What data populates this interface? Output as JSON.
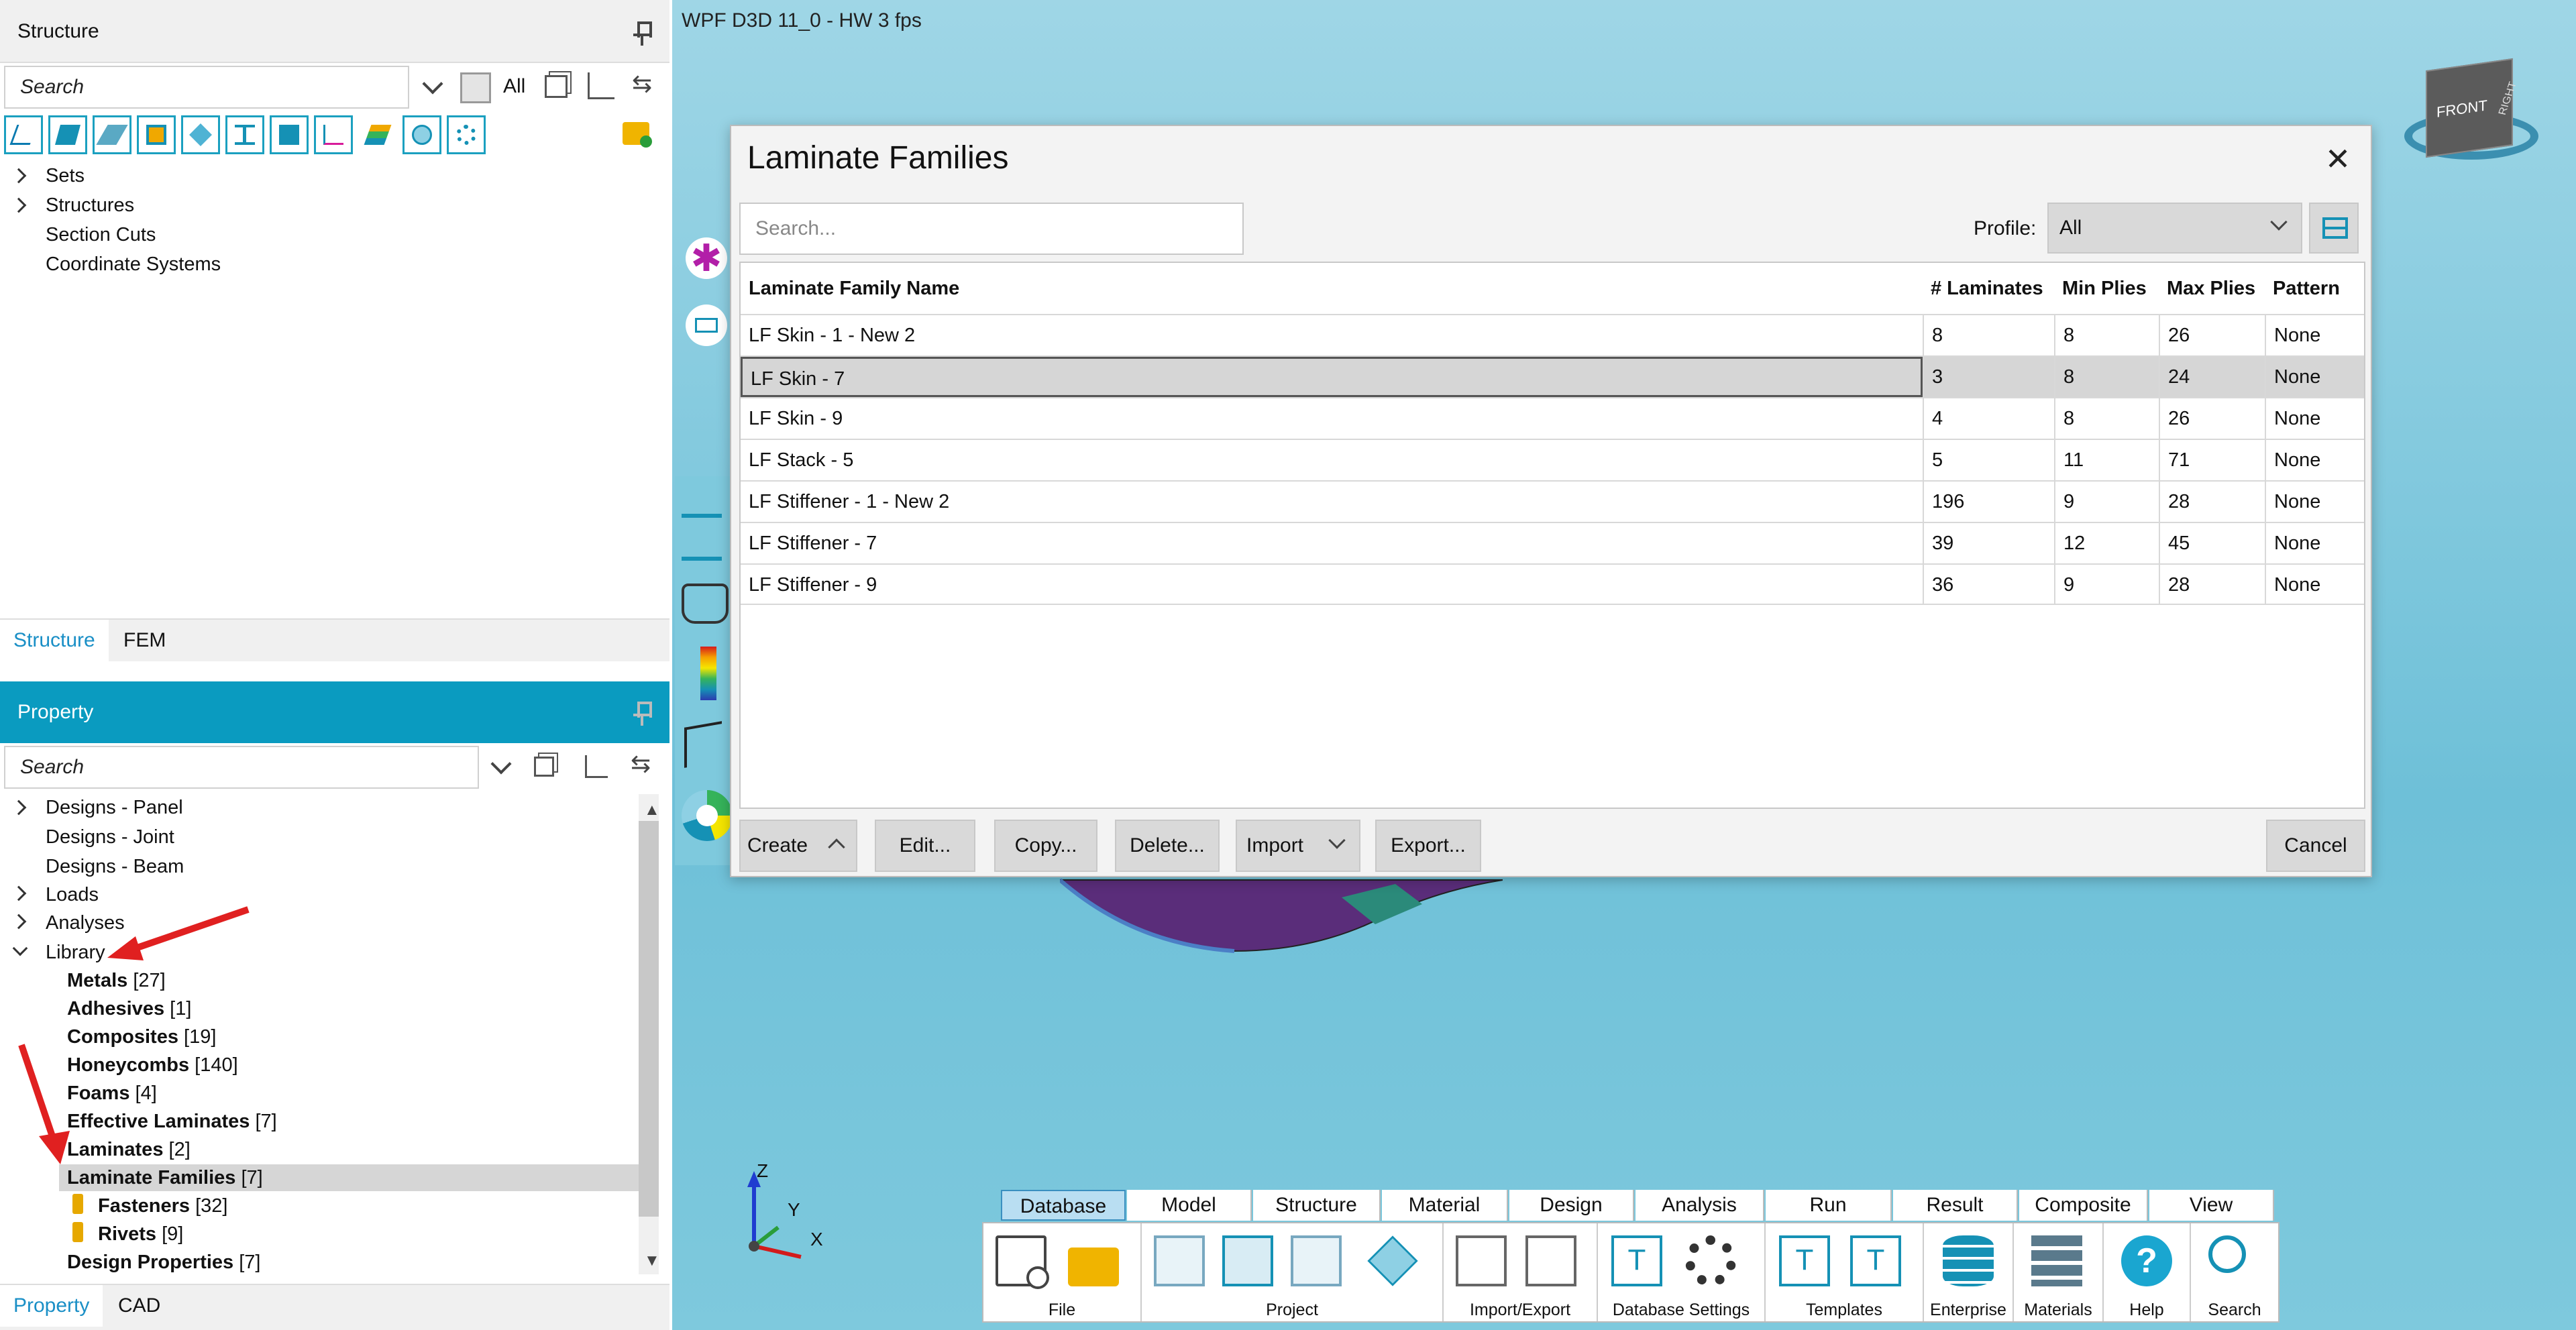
{
  "structure": {
    "title": "Structure",
    "search_placeholder": "Search",
    "all_label": "All",
    "tree": [
      "Sets",
      "Structures",
      "Section Cuts",
      "Coordinate Systems"
    ],
    "tabs": [
      "Structure",
      "FEM"
    ]
  },
  "property": {
    "title": "Property",
    "search_placeholder": "Search",
    "top_items": [
      "Designs - Panel",
      "Designs - Joint",
      "Designs - Beam",
      "Loads",
      "Analyses",
      "Library"
    ],
    "library_items": [
      {
        "name": "Metals",
        "count": "[27]"
      },
      {
        "name": "Adhesives",
        "count": "[1]"
      },
      {
        "name": "Composites",
        "count": "[19]"
      },
      {
        "name": "Honeycombs",
        "count": "[140]"
      },
      {
        "name": "Foams",
        "count": "[4]"
      },
      {
        "name": "Effective Laminates",
        "count": "[7]"
      },
      {
        "name": "Laminates",
        "count": "[2]"
      },
      {
        "name": "Laminate Families",
        "count": "[7]"
      },
      {
        "name": "Fasteners",
        "count": "[32]"
      },
      {
        "name": "Rivets",
        "count": "[9]"
      },
      {
        "name": "Design Properties",
        "count": "[7]"
      }
    ],
    "tabs": [
      "Property",
      "CAD"
    ]
  },
  "viewport": {
    "status": "WPF D3D 11_0 - HW  3 fps",
    "cube_front": "FRONT",
    "cube_right": "RIGHT",
    "axis_z": "Z",
    "axis_y": "Y",
    "axis_x": "X"
  },
  "dialog": {
    "title": "Laminate Families",
    "close": "✕",
    "search_placeholder": "Search...",
    "profile_label": "Profile:",
    "profile_value": "All",
    "columns": [
      "Laminate Family Name",
      "# Laminates",
      "Min Plies",
      "Max Plies",
      "Pattern"
    ],
    "rows": [
      [
        "LF Skin - 1 - New 2",
        "8",
        "8",
        "26",
        "None"
      ],
      [
        "LF Skin - 7",
        "3",
        "8",
        "24",
        "None"
      ],
      [
        "LF Skin - 9",
        "4",
        "8",
        "26",
        "None"
      ],
      [
        "LF Stack - 5",
        "5",
        "11",
        "71",
        "None"
      ],
      [
        "LF Stiffener - 1 - New 2",
        "196",
        "9",
        "28",
        "None"
      ],
      [
        "LF Stiffener - 7",
        "39",
        "12",
        "45",
        "None"
      ],
      [
        "LF Stiffener - 9",
        "36",
        "9",
        "28",
        "None"
      ]
    ],
    "buttons": {
      "create": "Create",
      "edit": "Edit...",
      "copy": "Copy...",
      "delete": "Delete...",
      "import": "Import",
      "export": "Export...",
      "cancel": "Cancel"
    }
  },
  "ribbon": {
    "tabs": [
      "Database",
      "Model",
      "Structure",
      "Material",
      "Design",
      "Analysis",
      "Run",
      "Result",
      "Composite",
      "View"
    ],
    "groups": [
      "File",
      "Project",
      "Import/Export",
      "Database Settings",
      "Templates",
      "Enterprise",
      "Materials",
      "Help",
      "Search"
    ]
  },
  "colors": {
    "accent": "#0a9bc0",
    "selection": "#d6d6d6",
    "arrow": "#e02020"
  }
}
